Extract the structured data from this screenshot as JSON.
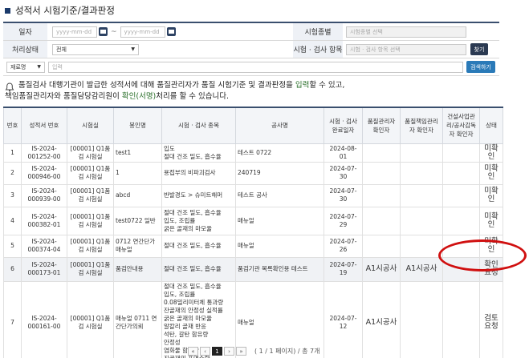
{
  "page": {
    "title": "성적서 시험기준/결과판정"
  },
  "search": {
    "date_label": "일자",
    "date_from_placeholder": "yyyy-mm-dd",
    "date_sep": "~",
    "date_to_placeholder": "yyyy-mm-dd",
    "test_type_label": "시험종별",
    "test_type_placeholder": "시험종별 선택",
    "status_label": "처리상태",
    "status_value": "전체",
    "test_items_label": "시험 · 검사 항목",
    "test_items_placeholder": "시험 · 검사 항목 선택",
    "find_button": "찾기",
    "material_select": "재료명",
    "keyword_placeholder": "입력",
    "search_button": "검색하기"
  },
  "notice": {
    "line1_a": "품질검사 대행기관이 발급한 성적서에 대해 품질관리자가 품질 시험기준 및 결과판정을 ",
    "line1_hl": "입력",
    "line1_b": "할 수 있고,",
    "line2_a": "책임품질관리자와 품질담당감리원이 ",
    "line2_hl": "확인(서명)",
    "line2_b": "처리를 할 수 있습니다."
  },
  "table": {
    "headers": [
      "번호",
      "성적서 번호",
      "시험실",
      "봉인명",
      "시험 · 검사 종목",
      "공사명",
      "시험 · 검사 완료일자",
      "품질관리자 확인자",
      "품질책임관리자 확인자",
      "건설사업관리/공사감독자 확인자",
      "상태"
    ],
    "rows": [
      {
        "no": "1",
        "report": "IS-2024-001252-00",
        "lab": "[00001] Q1품검 시험실",
        "seal": "test1",
        "items": "입도\n절대 건조 밀도, 흡수율",
        "project": "테스트 0722",
        "date": "2024-08-01",
        "qm": "",
        "qrm": "",
        "cm": "",
        "status": "미확인"
      },
      {
        "no": "2",
        "report": "IS-2024-000946-00",
        "lab": "[00001] Q1품검 시험실",
        "seal": "1",
        "items": "용접부의 비파괴검사",
        "project": "240719",
        "date": "2024-07-30",
        "qm": "",
        "qrm": "",
        "cm": "",
        "status": "미확인"
      },
      {
        "no": "3",
        "report": "IS-2024-000939-00",
        "lab": "[00001] Q1품검 시험실",
        "seal": "abcd",
        "items": "반발경도 > 슈미트해머",
        "project": "테스트 공사",
        "date": "2024-07-30",
        "qm": "",
        "qrm": "",
        "cm": "",
        "status": "미확인"
      },
      {
        "no": "4",
        "report": "IS-2024-000382-01",
        "lab": "[00001] Q1품검 시험실",
        "seal": "test0722 일반",
        "items": "절대 건조 밀도, 흡수율\n입도, 조립률\n굵은 골재의 마모율",
        "project": "매뉴얼",
        "date": "2024-07-29",
        "qm": "",
        "qrm": "",
        "cm": "",
        "status": "미확인"
      },
      {
        "no": "5",
        "report": "IS-2024-000374-04",
        "lab": "[00001] Q1품검 시험실",
        "seal": "0712 연간단가 매뉴얼",
        "items": "절대 건조 밀도, 흡수율",
        "project": "매뉴얼",
        "date": "2024-07-26",
        "qm": "",
        "qrm": "",
        "cm": "",
        "status": "미확인"
      },
      {
        "no": "6",
        "report": "IS-2024-000173-01",
        "lab": "[00001] Q1품검 시험실",
        "seal": "품검안내용",
        "items": "절대 건조 밀도, 흡수율",
        "project": "품검기관 목록확인용 테스트",
        "date": "2024-07-19",
        "qm": "A1시공사",
        "qrm": "A1시공사",
        "cm": "",
        "status": "확인요청"
      },
      {
        "no": "7",
        "report": "IS-2024-000161-00",
        "lab": "[00001] Q1품검 시험실",
        "seal": "매뉴얼 0711 연간단가의뢰",
        "items": "절대 건조 밀도, 흡수율\n입도, 조립률\n0.08밀리미터체 통과량\n잔골재의 안정성 실적률\n굵은 골재의 마모율\n알칼리 골재 반응\n석탄, 갈탄 함유량\n안정성\n염화물 함유량\n진골재의 표면수량",
        "project": "매뉴얼",
        "date": "2024-07-12",
        "qm": "A1시공사",
        "qrm": "",
        "cm": "",
        "status": "검토요청"
      }
    ]
  },
  "pager": {
    "first": "«",
    "prev": "‹",
    "current": "1",
    "next": "›",
    "last": "»",
    "info": "( 1 / 1 페이지) / 총 7개"
  },
  "colors": {
    "header_bar": "#3a4f6e",
    "highlight_oval": "#d01010",
    "notice_highlight": "#2a6f2a"
  }
}
